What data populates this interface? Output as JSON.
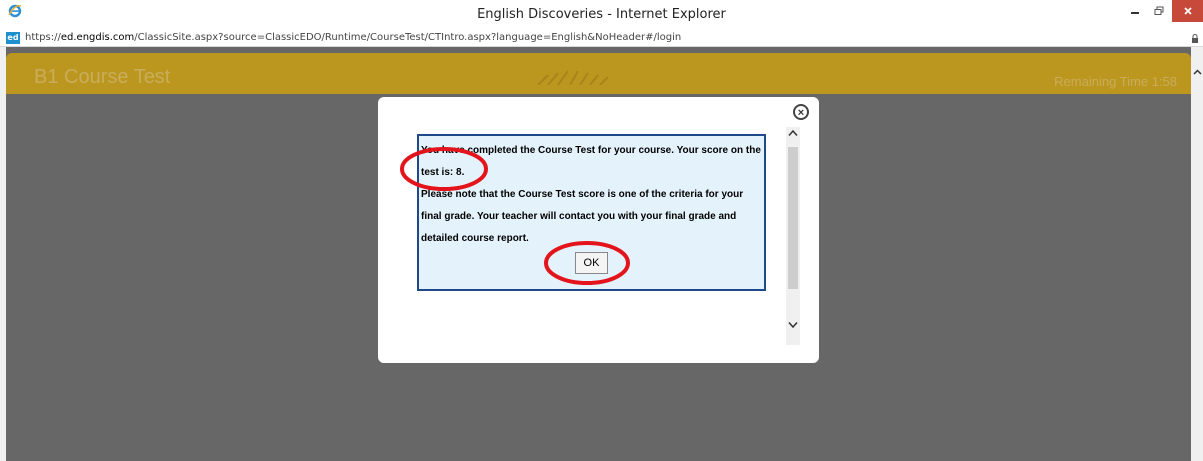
{
  "window": {
    "title": "English Discoveries - Internet Explorer",
    "close_color": "#c7493a"
  },
  "address": {
    "scheme": "https://",
    "host": "ed.engdis.com",
    "path": "/ClassicSite.aspx?source=ClassicEDO/Runtime/CourseTest/CTIntro.aspx?language=English&NoHeader#/login",
    "favicon_text": "ed"
  },
  "page": {
    "course_title": "B1 Course Test",
    "remaining_time": "Remaining Time 1:58",
    "header_color": "#bb9720",
    "backdrop_color": "#676767"
  },
  "dialog": {
    "line1": "You have completed the Course Test for your course. Your score on the",
    "line2_prefix": "test is: ",
    "score": "8",
    "line2_suffix": ".",
    "line3": "Please note that the Course Test score is one of the criteria for your",
    "line4": "final grade. Your teacher will contact you with your final grade and",
    "line5": "detailed course report.",
    "ok_label": "OK",
    "close_glyph": "×"
  },
  "icons": {
    "browser": "ie-icon",
    "minimize": "minimize-icon",
    "maximize": "maximize-icon",
    "close": "close-icon",
    "lock": "lock-icon"
  },
  "annotation_color": "#e3141b"
}
